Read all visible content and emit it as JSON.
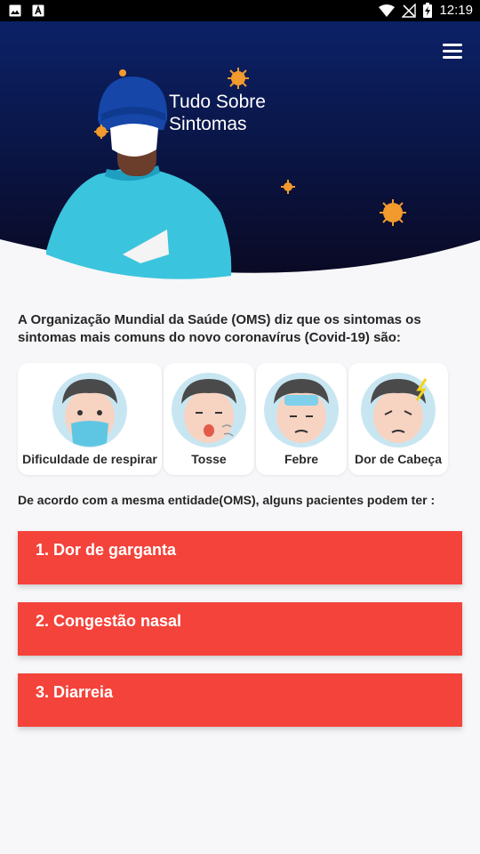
{
  "status_bar": {
    "time": "12:19",
    "left_icons": [
      "image-icon",
      "text-format-icon"
    ],
    "right_icons": [
      "wifi-icon",
      "no-signal-icon",
      "battery-charging-icon"
    ]
  },
  "header": {
    "title": "Tudo Sobre Sintomas",
    "menu_icon": "hamburger-menu-icon",
    "colors": {
      "gradient_top": "#0b2167",
      "gradient_bottom": "#0a0a25",
      "virus": "#f29a2e",
      "gown": "#3bc4dd",
      "cap": "#1546a8"
    }
  },
  "intro": {
    "text": "A Organização Mundial da Saúde (OMS) diz que os sintomas os sintomas mais comuns do novo coronavírus (Covid-19) são:"
  },
  "common_symptoms": [
    {
      "label": "Dificuldade de respirar",
      "icon": "face-mask-icon"
    },
    {
      "label": "Tosse",
      "icon": "face-cough-icon"
    },
    {
      "label": "Febre",
      "icon": "face-fever-icon"
    },
    {
      "label": "Dor de Cabeça",
      "icon": "face-headache-icon"
    }
  ],
  "subtitle": "De acordo com a mesma entidade(OMS), alguns pacientes podem ter :",
  "other_symptoms": [
    {
      "label": "1. Dor de garganta"
    },
    {
      "label": "2. Congestão nasal"
    },
    {
      "label": "3. Diarreia"
    }
  ],
  "colors": {
    "accent": "#f4433a",
    "background": "#f7f7f9",
    "card": "#ffffff"
  }
}
